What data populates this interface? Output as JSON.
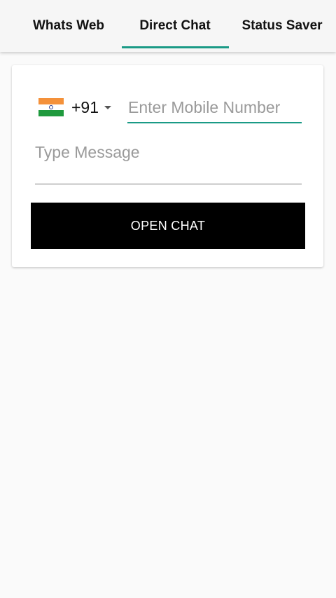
{
  "tabs": [
    {
      "label": "Whats Web",
      "selected": false
    },
    {
      "label": "Direct Chat",
      "selected": true
    },
    {
      "label": "Status Saver",
      "selected": false
    }
  ],
  "country": {
    "dial_code": "+91",
    "flag_icon": "india-flag-icon"
  },
  "phone": {
    "placeholder": "Enter Mobile Number",
    "value": ""
  },
  "message": {
    "placeholder": "Type Message",
    "value": ""
  },
  "open_chat_label": "OPEN CHAT",
  "colors": {
    "accent": "#1a9a86",
    "button_bg": "#000000",
    "button_text": "#ffffff",
    "flag_saffron": "#f4913a",
    "flag_white": "#ffffff",
    "flag_green": "#1f9a3e"
  }
}
